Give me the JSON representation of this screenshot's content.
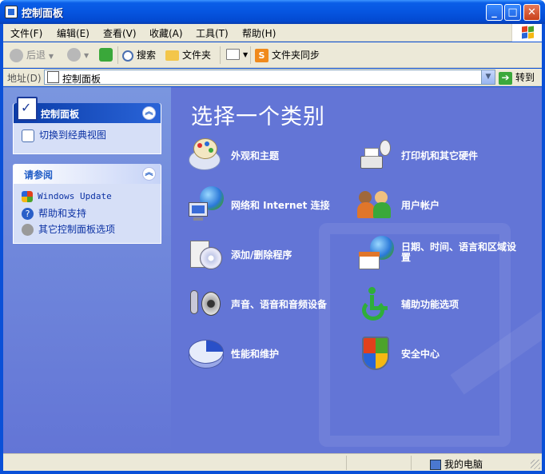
{
  "window": {
    "title": "控制面板"
  },
  "menu": [
    "文件(F)",
    "编辑(E)",
    "查看(V)",
    "收藏(A)",
    "工具(T)",
    "帮助(H)"
  ],
  "toolbar": {
    "back": "后退",
    "search": "搜索",
    "folders": "文件夹",
    "sync": "文件夹同步"
  },
  "address": {
    "label": "地址(D)",
    "value": "控制面板",
    "go": "转到"
  },
  "left_panel": {
    "control_panel": {
      "title": "控制面板",
      "switch_link": "切换到经典视图"
    },
    "see_also": {
      "title": "请参阅",
      "links": [
        "Windows Update",
        "帮助和支持",
        "其它控制面板选项"
      ]
    }
  },
  "content": {
    "heading": "选择一个类别",
    "categories": [
      {
        "label": "外观和主题",
        "icon": "appearance-icon"
      },
      {
        "label": "打印机和其它硬件",
        "icon": "printer-icon"
      },
      {
        "label": "网络和 Internet 连接",
        "icon": "network-icon"
      },
      {
        "label": "用户帐户",
        "icon": "users-icon"
      },
      {
        "label": "添加/删除程序",
        "icon": "add-remove-icon"
      },
      {
        "label": "日期、时间、语言和区域设置",
        "icon": "datetime-icon"
      },
      {
        "label": "声音、语音和音频设备",
        "icon": "sound-icon"
      },
      {
        "label": "辅助功能选项",
        "icon": "accessibility-icon"
      },
      {
        "label": "性能和维护",
        "icon": "performance-icon"
      },
      {
        "label": "安全中心",
        "icon": "security-shield-icon"
      }
    ]
  },
  "status": {
    "zone": "我的电脑"
  },
  "colors": {
    "title_blue": "#0655e0",
    "content_blue": "#6375d6",
    "link": "#0c32a4"
  }
}
